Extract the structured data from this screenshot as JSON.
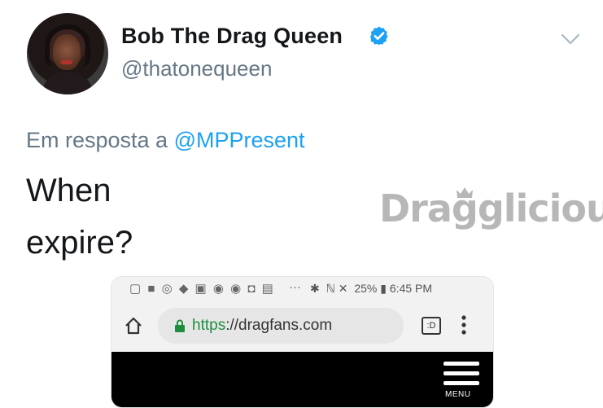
{
  "tweet": {
    "author_name": "Bob The Drag Queen",
    "handle": "@thatonequeen",
    "reply_prefix": "Em resposta a",
    "reply_mention": "@MPPresent",
    "text_line1": "When",
    "text_line2": "expire?"
  },
  "watermark": {
    "text": "Dragglicious"
  },
  "icons": {
    "verified": "verified-badge-icon",
    "chevron": "chevron-down-icon",
    "home": "home-icon",
    "lock": "lock-icon",
    "tabs": "tabs-icon",
    "menu": "more-vert-icon",
    "hamburger": "hamburger-menu-icon"
  },
  "embedded_screenshot": {
    "status_icons": "▢ ■ ◎ ◆ ▣ ◉ ◉ ◘ ▤",
    "status_more": "···",
    "bluetooth": "✱",
    "signal_icons": "ℕ ✕",
    "battery": "25%",
    "time": "6:45 PM",
    "url_scheme": "https",
    "url_rest": "://dragfans.com",
    "tabs_label": ":D",
    "site_menu_label": "MENU"
  },
  "colors": {
    "accent": "#1da1f2",
    "secondary_text": "#657786",
    "primary_text": "#14171a",
    "secure_green": "#1e8e3e"
  }
}
